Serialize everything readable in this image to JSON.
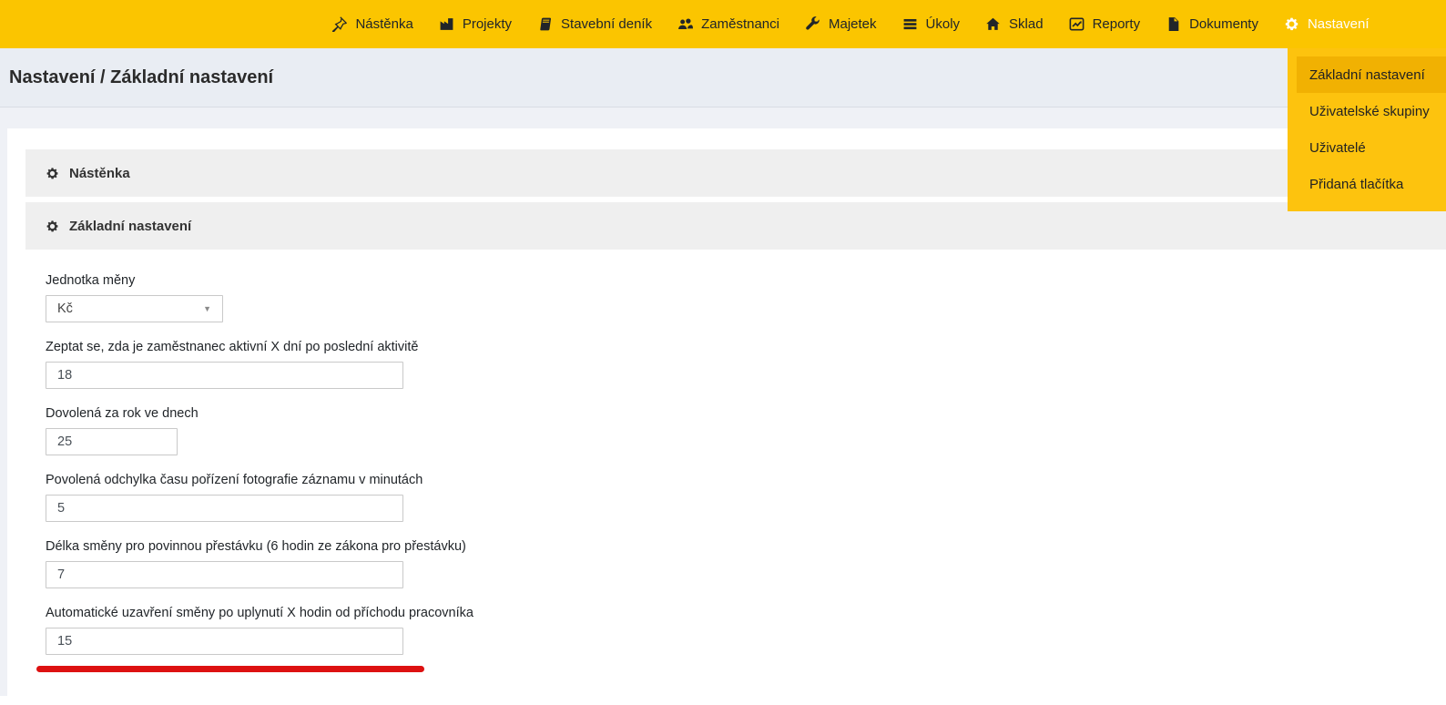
{
  "navbar": {
    "items": [
      {
        "label": "Nástěnka",
        "icon": "pin-icon"
      },
      {
        "label": "Projekty",
        "icon": "factory-icon"
      },
      {
        "label": "Stavební deník",
        "icon": "book-icon"
      },
      {
        "label": "Zaměstnanci",
        "icon": "users-icon"
      },
      {
        "label": "Majetek",
        "icon": "wrench-icon"
      },
      {
        "label": "Úkoly",
        "icon": "tasks-icon"
      },
      {
        "label": "Sklad",
        "icon": "home-icon"
      },
      {
        "label": "Reporty",
        "icon": "chart-line-icon"
      },
      {
        "label": "Dokumenty",
        "icon": "file-icon"
      },
      {
        "label": "Nastavení",
        "icon": "gear-icon",
        "active": true
      }
    ]
  },
  "dropdown": {
    "items": [
      {
        "label": "Základní nastavení",
        "active": true
      },
      {
        "label": "Uživatelské skupiny"
      },
      {
        "label": "Uživatelé"
      },
      {
        "label": "Přidaná tlačítka"
      }
    ]
  },
  "header": {
    "title": "Nastavení / Základní nastavení"
  },
  "sections": [
    {
      "title": "Nástěnka"
    },
    {
      "title": "Základní nastavení"
    }
  ],
  "form": {
    "fields": [
      {
        "label": "Jednotka měny",
        "value": "Kč",
        "type": "select"
      },
      {
        "label": "Zeptat se, zda je zaměstnanec aktivní X dní po poslední aktivitě",
        "value": "18",
        "type": "text"
      },
      {
        "label": "Dovolená za rok ve dnech",
        "value": "25",
        "type": "text"
      },
      {
        "label": "Povolená odchylka času pořízení fotografie záznamu v minutách",
        "value": "5",
        "type": "text"
      },
      {
        "label": "Délka směny pro povinnou přestávku (6 hodin ze zákona pro přestávku)",
        "value": "7",
        "type": "text"
      },
      {
        "label": "Automatické uzavření směny po uplynutí X hodin od příchodu pracovníka",
        "value": "15",
        "type": "text"
      }
    ]
  },
  "annotation": {
    "type": "red-underline"
  },
  "colors": {
    "navbar_bg": "#fbc500",
    "dropdown_bg": "#fdc30e",
    "dropdown_active_bg": "#f1b102",
    "nav_active_text": "#ffffff",
    "header_bg": "#e9edf3",
    "page_bg": "#eff1f6",
    "accordion_bg": "#efefef",
    "annotation_red": "#dd1111"
  }
}
